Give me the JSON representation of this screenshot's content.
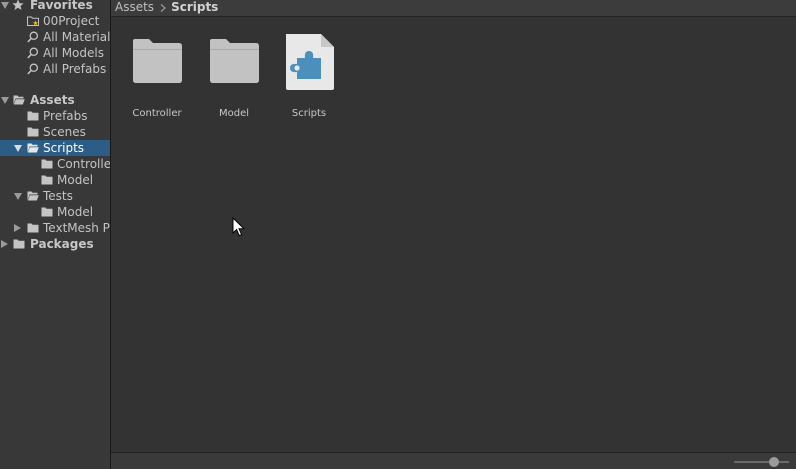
{
  "tree": {
    "favorites": {
      "label": "Favorites",
      "items": [
        {
          "label": "00Project",
          "icon": "favorite-folder-icon"
        },
        {
          "label": "All Materials",
          "icon": "search-icon"
        },
        {
          "label": "All Models",
          "icon": "search-icon"
        },
        {
          "label": "All Prefabs",
          "icon": "search-icon"
        }
      ]
    },
    "assets": {
      "label": "Assets",
      "items": [
        {
          "label": "Prefabs"
        },
        {
          "label": "Scenes"
        },
        {
          "label": "Scripts",
          "selected": true,
          "children": [
            "Controlle",
            "Model"
          ]
        },
        {
          "label": "Tests",
          "children": [
            "Model"
          ]
        },
        {
          "label": "TextMesh P"
        }
      ]
    },
    "packages": {
      "label": "Packages"
    }
  },
  "breadcrumb": {
    "root": "Assets",
    "current": "Scripts"
  },
  "grid": [
    {
      "label": "Controller",
      "icon": "folder-icon"
    },
    {
      "label": "Model",
      "icon": "folder-icon"
    },
    {
      "label": "Scripts",
      "icon": "assembly-definition-icon"
    }
  ],
  "zoom": {
    "value": 0.72
  },
  "colors": {
    "panel": "#383838",
    "content": "#333333",
    "selection": "#2c5d87",
    "folder": "#c2c2c2",
    "asmdef": "#4c8fbd"
  }
}
